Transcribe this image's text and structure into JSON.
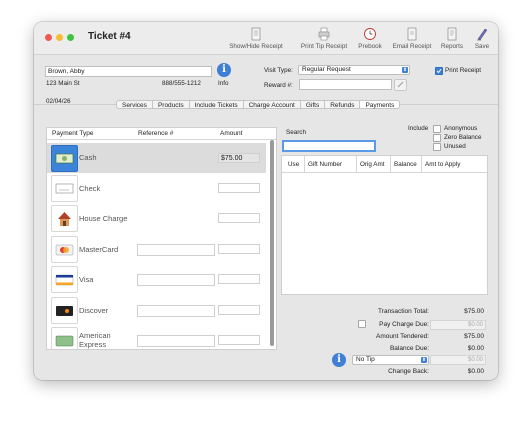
{
  "window": {
    "title": "Ticket #4"
  },
  "toolbar": [
    {
      "label": "Show/Hide Receipt",
      "icon": "receipt-icon"
    },
    {
      "label": "Print Tip Receipt",
      "icon": "printer-icon"
    },
    {
      "label": "Prebook",
      "icon": "clock-icon"
    },
    {
      "label": "Email Receipt",
      "icon": "email-icon"
    },
    {
      "label": "Reports",
      "icon": "reports-icon"
    },
    {
      "label": "Save",
      "icon": "save-icon"
    }
  ],
  "client": {
    "name": "Brown, Abby",
    "address": "123 Main St",
    "phone": "888/555-1212",
    "info_label": "Info",
    "date": "02/04/26"
  },
  "visit": {
    "type_label": "Visit Type:",
    "type_value": "Regular Request",
    "reward_label": "Reward #:",
    "reward_value": "",
    "print_receipt_label": "Print Receipt"
  },
  "tabs": [
    "Services",
    "Products",
    "Include Tickets",
    "Charge Account",
    "Gifts",
    "Refunds",
    "Payments"
  ],
  "payments": {
    "headers": [
      "Payment Type",
      "Reference #",
      "Amount"
    ],
    "rows": [
      {
        "label": "Cash",
        "amount": "$75.00",
        "icon": "cash-icon"
      },
      {
        "label": "Check",
        "amount": "",
        "icon": "check-icon"
      },
      {
        "label": "House Charge",
        "amount": "",
        "icon": "house-icon"
      },
      {
        "label": "MasterCard",
        "amount": "",
        "icon": "mastercard-icon"
      },
      {
        "label": "Visa",
        "amount": "",
        "icon": "visa-icon"
      },
      {
        "label": "Discover",
        "amount": "",
        "icon": "discover-icon"
      },
      {
        "label": "American Express",
        "amount": "",
        "icon": "amex-icon"
      }
    ]
  },
  "gift": {
    "search_label": "Search",
    "search_value": "",
    "include_label": "Include",
    "include_options": [
      "Anonymous",
      "Zero Balance",
      "Unused"
    ],
    "headers": [
      "Use",
      "Gift Number",
      "Orig Amt",
      "Balance",
      "Amt to Apply"
    ]
  },
  "totals": {
    "transaction_total_label": "Transaction Total:",
    "transaction_total": "$75.00",
    "pay_charge_due_label": "Pay Charge Due:",
    "pay_charge_due": "$0.00",
    "amount_tendered_label": "Amount Tendered:",
    "amount_tendered": "$75.00",
    "balance_due_label": "Balance Due:",
    "balance_due": "$0.00",
    "tip_option": "No Tip",
    "tip_amount": "$0.00",
    "change_back_label": "Change Back:",
    "change_back": "$0.00"
  }
}
